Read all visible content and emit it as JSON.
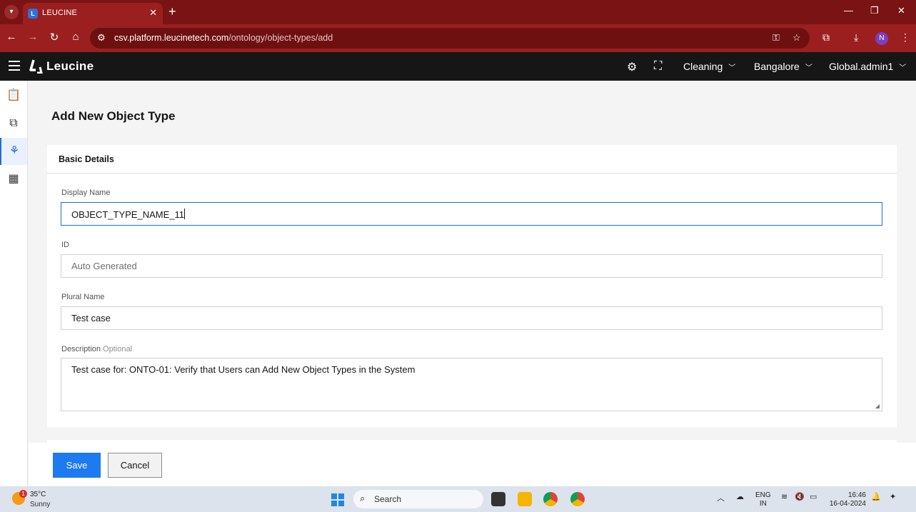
{
  "browser": {
    "tab_title": "LEUCINE",
    "url_host": "csv.platform.leucinetech.com",
    "url_path": "/ontology/object-types/add",
    "profile_initial": "N"
  },
  "header": {
    "brand": "Leucine",
    "facility_menu": "Cleaning",
    "site_menu": "Bangalore",
    "user_menu": "Global.admin1"
  },
  "page": {
    "title": "Add New Object Type",
    "section_title": "Basic Details"
  },
  "form": {
    "display_name": {
      "label": "Display Name",
      "value": "OBJECT_TYPE_NAME_11"
    },
    "id": {
      "label": "ID",
      "placeholder": "Auto Generated"
    },
    "plural_name": {
      "label": "Plural Name",
      "value": "Test case"
    },
    "description": {
      "label": "Description",
      "optional": "Optional",
      "value": "Test case for: ONTO-01: Verify that Users can Add New Object Types in the System"
    }
  },
  "actions": {
    "save": "Save",
    "cancel": "Cancel"
  },
  "taskbar": {
    "weather_badge": "1",
    "temperature": "35°C",
    "weather": "Sunny",
    "search": "Search",
    "lang_top": "ENG",
    "lang_bottom": "IN",
    "time": "16:46",
    "date": "16-04-2024"
  },
  "colors": {
    "accent": "#1d7af0",
    "browser_frame": "#9b1f1f",
    "appbar": "#161616"
  }
}
